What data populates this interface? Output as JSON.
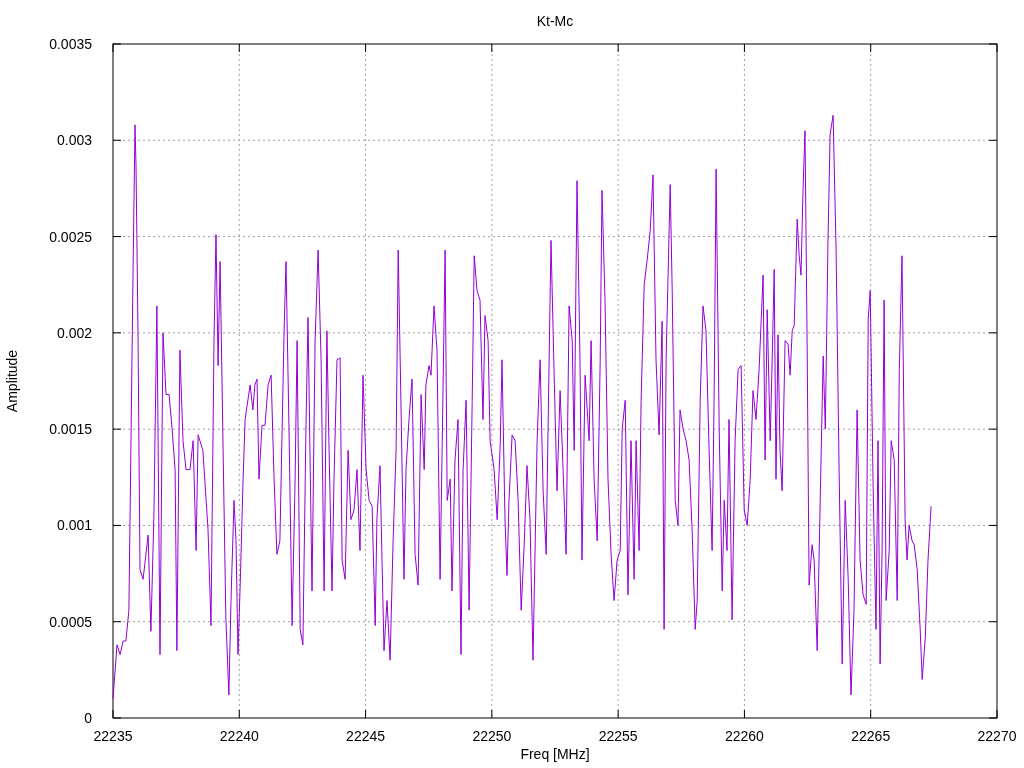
{
  "plot": {
    "chart_data": {
      "type": "line",
      "title": "Kt-Mc",
      "xlabel": "Freq [MHz]",
      "ylabel": "Amplitude",
      "xlim": [
        22235,
        22270
      ],
      "ylim": [
        0,
        0.0035
      ],
      "grid": true,
      "xticks": [
        22235,
        22240,
        22245,
        22250,
        22255,
        22260,
        22265,
        22270
      ],
      "yticks": [
        0,
        0.0005,
        0.001,
        0.0015,
        0.002,
        0.0025,
        0.003,
        0.0035
      ],
      "x": [
        22235.0,
        22235.16,
        22235.28,
        22235.4,
        22235.51,
        22235.63,
        22235.71,
        22235.79,
        22235.87,
        22235.91,
        22235.99,
        22236.07,
        22236.19,
        22236.39,
        22236.5,
        22236.62,
        22236.74,
        22236.86,
        22236.98,
        22237.1,
        22237.22,
        22237.34,
        22237.46,
        22237.53,
        22237.65,
        22237.77,
        22237.89,
        22238.05,
        22238.17,
        22238.29,
        22238.37,
        22238.56,
        22238.76,
        22238.88,
        22239.0,
        22239.08,
        22239.16,
        22239.24,
        22239.36,
        22239.47,
        22239.59,
        22239.67,
        22239.79,
        22239.87,
        22239.95,
        22240.03,
        22240.15,
        22240.23,
        22240.43,
        22240.54,
        22240.62,
        22240.7,
        22240.78,
        22240.9,
        22241.02,
        22241.14,
        22241.26,
        22241.38,
        22241.49,
        22241.61,
        22241.77,
        22241.85,
        22241.97,
        22242.09,
        22242.21,
        22242.29,
        22242.41,
        22242.52,
        22242.64,
        22242.72,
        22242.88,
        22243.0,
        22243.12,
        22243.24,
        22243.36,
        22243.47,
        22243.55,
        22243.67,
        22243.75,
        22243.87,
        22243.99,
        22244.07,
        22244.19,
        22244.31,
        22244.42,
        22244.54,
        22244.66,
        22244.78,
        22244.9,
        22245.02,
        22245.14,
        22245.26,
        22245.38,
        22245.45,
        22245.57,
        22245.65,
        22245.73,
        22245.85,
        22245.97,
        22246.09,
        22246.21,
        22246.29,
        22246.4,
        22246.52,
        22246.6,
        22246.72,
        22246.84,
        22246.96,
        22247.08,
        22247.2,
        22247.32,
        22247.39,
        22247.51,
        22247.59,
        22247.71,
        22247.83,
        22247.95,
        22248.03,
        22248.15,
        22248.23,
        22248.35,
        22248.42,
        22248.54,
        22248.66,
        22248.78,
        22248.86,
        22248.98,
        22249.1,
        22249.22,
        22249.3,
        22249.41,
        22249.53,
        22249.65,
        22249.73,
        22249.85,
        22249.93,
        22250.09,
        22250.21,
        22250.33,
        22250.4,
        22250.52,
        22250.6,
        22250.68,
        22250.8,
        22250.92,
        22251.04,
        22251.16,
        22251.28,
        22251.39,
        22251.51,
        22251.63,
        22251.79,
        22251.91,
        22252.03,
        22252.15,
        22252.23,
        22252.34,
        22252.46,
        22252.58,
        22252.7,
        22252.82,
        22252.94,
        22253.06,
        22253.18,
        22253.26,
        22253.37,
        22253.49,
        22253.57,
        22253.69,
        22253.85,
        22253.93,
        22254.05,
        22254.17,
        22254.29,
        22254.36,
        22254.48,
        22254.6,
        22254.72,
        22254.84,
        22254.96,
        22255.08,
        22255.16,
        22255.28,
        22255.39,
        22255.51,
        22255.63,
        22255.71,
        22255.83,
        22255.91,
        22256.03,
        22256.15,
        22256.27,
        22256.38,
        22256.5,
        22256.62,
        22256.74,
        22256.82,
        22256.9,
        22257.06,
        22257.14,
        22257.26,
        22257.37,
        22257.45,
        22257.57,
        22257.69,
        22257.81,
        22257.93,
        22258.05,
        22258.13,
        22258.25,
        22258.36,
        22258.48,
        22258.6,
        22258.72,
        22258.8,
        22258.88,
        22259.0,
        22259.12,
        22259.2,
        22259.31,
        22259.39,
        22259.51,
        22259.63,
        22259.75,
        22259.87,
        22259.99,
        22260.11,
        22260.23,
        22260.34,
        22260.46,
        22260.58,
        22260.74,
        22260.82,
        22260.9,
        22261.02,
        22261.1,
        22261.18,
        22261.25,
        22261.33,
        22261.41,
        22261.49,
        22261.61,
        22261.73,
        22261.81,
        22261.89,
        22261.97,
        22262.09,
        22262.17,
        22262.24,
        22262.32,
        22262.4,
        22262.48,
        22262.56,
        22262.68,
        22262.76,
        22262.88,
        22263.0,
        22263.12,
        22263.2,
        22263.31,
        22263.39,
        22263.51,
        22263.63,
        22263.75,
        22263.87,
        22263.99,
        22264.11,
        22264.22,
        22264.34,
        22264.46,
        22264.58,
        22264.7,
        22264.82,
        22264.9,
        22264.98,
        22265.1,
        22265.21,
        22265.29,
        22265.37,
        22265.45,
        22265.53,
        22265.61,
        22265.73,
        22265.81,
        22265.93,
        22266.05,
        22266.13,
        22266.24,
        22266.36,
        22266.44,
        22266.52,
        22266.64,
        22266.72,
        22266.84,
        22266.96,
        22267.04,
        22267.16,
        22267.27,
        22267.39
      ],
      "series": [
        {
          "color": "#9400d3",
          "values": [
            0.0001,
            0.00038,
            0.00033,
            0.0004,
            0.0004,
            0.00056,
            0.0014,
            0.0023,
            0.00308,
            0.00287,
            0.002,
            0.00077,
            0.00072,
            0.00095,
            0.00045,
            0.00105,
            0.00214,
            0.00033,
            0.002,
            0.00168,
            0.00168,
            0.0015,
            0.00129,
            0.00035,
            0.00191,
            0.00144,
            0.00129,
            0.00129,
            0.00144,
            0.00087,
            0.00147,
            0.00139,
            0.00098,
            0.00048,
            0.00196,
            0.00251,
            0.00183,
            0.00237,
            0.00139,
            0.00051,
            0.00012,
            0.00061,
            0.00113,
            0.00092,
            0.00033,
            0.00066,
            0.00124,
            0.00155,
            0.00173,
            0.0016,
            0.00173,
            0.00176,
            0.00124,
            0.00152,
            0.00152,
            0.00173,
            0.00178,
            0.00124,
            0.00085,
            0.00092,
            0.00199,
            0.00237,
            0.0015,
            0.00048,
            0.00124,
            0.00196,
            0.00046,
            0.00038,
            0.00152,
            0.00208,
            0.00066,
            0.00196,
            0.00243,
            0.00186,
            0.00066,
            0.00201,
            0.00144,
            0.00066,
            0.00124,
            0.00186,
            0.00187,
            0.00082,
            0.00072,
            0.00139,
            0.00103,
            0.00108,
            0.00129,
            0.00087,
            0.00178,
            0.00129,
            0.00113,
            0.0011,
            0.00048,
            0.00103,
            0.00131,
            0.00082,
            0.00035,
            0.00061,
            0.0003,
            0.00092,
            0.00139,
            0.00243,
            0.00165,
            0.00072,
            0.00129,
            0.00155,
            0.00176,
            0.00085,
            0.00069,
            0.00168,
            0.00129,
            0.00173,
            0.00183,
            0.00178,
            0.00214,
            0.00191,
            0.00072,
            0.00139,
            0.00243,
            0.00113,
            0.00124,
            0.00066,
            0.00134,
            0.00155,
            0.00033,
            0.00129,
            0.00165,
            0.00056,
            0.00165,
            0.0024,
            0.00222,
            0.00217,
            0.00155,
            0.00209,
            0.00196,
            0.00144,
            0.00129,
            0.00103,
            0.00142,
            0.00186,
            0.00103,
            0.00074,
            0.00113,
            0.00147,
            0.00144,
            0.00113,
            0.00056,
            0.0009,
            0.00131,
            0.00103,
            0.0003,
            0.00144,
            0.00186,
            0.00118,
            0.00085,
            0.00155,
            0.00248,
            0.00181,
            0.00118,
            0.0017,
            0.00129,
            0.00085,
            0.00214,
            0.00196,
            0.00139,
            0.00279,
            0.00186,
            0.00082,
            0.00178,
            0.00144,
            0.00196,
            0.00124,
            0.00092,
            0.00186,
            0.00274,
            0.00217,
            0.00124,
            0.00085,
            0.00061,
            0.00082,
            0.00087,
            0.0015,
            0.00165,
            0.00064,
            0.00144,
            0.00072,
            0.00144,
            0.00087,
            0.00165,
            0.00225,
            0.00238,
            0.00253,
            0.00282,
            0.00186,
            0.00147,
            0.00206,
            0.00046,
            0.00186,
            0.00277,
            0.00222,
            0.00113,
            0.001,
            0.0016,
            0.0015,
            0.00144,
            0.00134,
            0.00098,
            0.00046,
            0.00061,
            0.00165,
            0.00214,
            0.00201,
            0.00139,
            0.00087,
            0.00165,
            0.00285,
            0.0015,
            0.00066,
            0.00113,
            0.00087,
            0.00155,
            0.00051,
            0.00144,
            0.00181,
            0.00183,
            0.00108,
            0.001,
            0.00124,
            0.0017,
            0.00155,
            0.00181,
            0.0023,
            0.00134,
            0.00212,
            0.00144,
            0.00186,
            0.00233,
            0.00124,
            0.00199,
            0.00139,
            0.00118,
            0.00196,
            0.00194,
            0.00178,
            0.00201,
            0.00204,
            0.00259,
            0.0024,
            0.0023,
            0.00274,
            0.00305,
            0.00196,
            0.00069,
            0.0009,
            0.00082,
            0.00035,
            0.00113,
            0.00188,
            0.0015,
            0.00248,
            0.00303,
            0.00313,
            0.00243,
            0.00129,
            0.00028,
            0.00113,
            0.00072,
            0.00012,
            0.00056,
            0.0016,
            0.00082,
            0.00064,
            0.00059,
            0.00207,
            0.00222,
            0.00118,
            0.00046,
            0.00144,
            0.00028,
            0.00087,
            0.00217,
            0.00061,
            0.00087,
            0.00144,
            0.00134,
            0.00061,
            0.00181,
            0.0024,
            0.00103,
            0.00082,
            0.001,
            0.00092,
            0.0009,
            0.00077,
            0.00046,
            0.0002,
            0.00042,
            0.00082,
            0.0011
          ]
        }
      ]
    }
  }
}
